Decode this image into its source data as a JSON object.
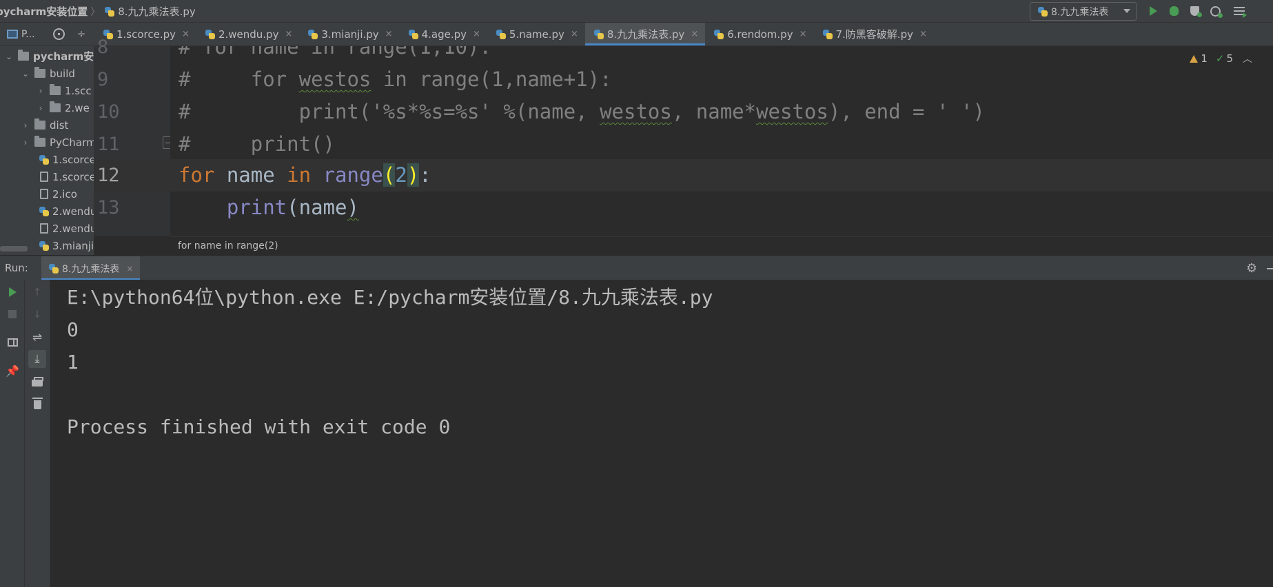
{
  "nav": {
    "root": "pycharm安装位置",
    "separator": "〉",
    "file": "8.九九乘法表.py",
    "run_config": "8.九九乘法表"
  },
  "project_panel": {
    "label": "P..."
  },
  "tabs": [
    {
      "label": "1.scorce.py",
      "active": false
    },
    {
      "label": "2.wendu.py",
      "active": false
    },
    {
      "label": "3.mianji.py",
      "active": false
    },
    {
      "label": "4.age.py",
      "active": false
    },
    {
      "label": "5.name.py",
      "active": false
    },
    {
      "label": "8.九九乘法表.py",
      "active": true
    },
    {
      "label": "6.rendom.py",
      "active": false
    },
    {
      "label": "7.防黑客破解.py",
      "active": false
    }
  ],
  "tab_close": "×",
  "tree": [
    {
      "label": "pycharm安",
      "type": "folder",
      "arrow": "⌄"
    },
    {
      "label": "build",
      "type": "folder",
      "arrow": "⌄"
    },
    {
      "label": "1.scc",
      "type": "folder",
      "arrow": "›"
    },
    {
      "label": "2.we",
      "type": "folder",
      "arrow": "›"
    },
    {
      "label": "dist",
      "type": "folder",
      "arrow": "›"
    },
    {
      "label": "PyCharm",
      "type": "folder",
      "arrow": "›"
    },
    {
      "label": "1.scorce",
      "type": "python"
    },
    {
      "label": "1.scorce",
      "type": "file"
    },
    {
      "label": "2.ico",
      "type": "file"
    },
    {
      "label": "2.wendu",
      "type": "python"
    },
    {
      "label": "2.wendu",
      "type": "file"
    },
    {
      "label": "3.mianji",
      "type": "python"
    }
  ],
  "editor": {
    "line_numbers": [
      "8",
      "9",
      "10",
      "11",
      "12",
      "13"
    ],
    "current_line": "12",
    "inspections": {
      "warnings": "1",
      "weak_warnings": "5"
    },
    "breadcrumb": "for name in range(2)"
  },
  "run": {
    "label": "Run:",
    "tab": "8.九九乘法表",
    "output": [
      "E:\\python64位\\python.exe E:/pycharm安装位置/8.九九乘法表.py",
      "0",
      "1",
      "",
      "Process finished with exit code 0"
    ]
  },
  "colors": {
    "keyword": "#cc7832",
    "builtin": "#8888c6",
    "number": "#6897bb",
    "comment": "#808080",
    "accent": "#4a88c7",
    "run_green": "#499c54"
  }
}
